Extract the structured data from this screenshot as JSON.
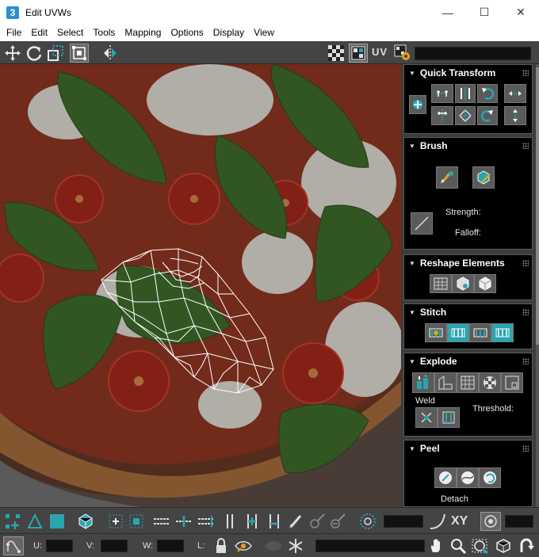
{
  "window": {
    "app_icon_text": "3",
    "title": "Edit UVWs",
    "minimize_glyph": "—",
    "maximize_glyph": "☐",
    "close_glyph": "✕"
  },
  "menu": [
    "File",
    "Edit",
    "Select",
    "Tools",
    "Mapping",
    "Options",
    "Display",
    "View"
  ],
  "toolbar": {
    "uv_label": "UV",
    "texture_dropdown_value": "",
    "icons": [
      "move-icon",
      "rotate-icon",
      "scale-icon",
      "freeform-icon",
      "mirror-icon",
      "checker-pattern-icon",
      "show-map-icon",
      "uv-label",
      "texture-settings-icon"
    ]
  },
  "panel": {
    "rollouts": [
      {
        "title": "Quick Transform"
      },
      {
        "title": "Brush"
      },
      {
        "title": "Reshape Elements"
      },
      {
        "title": "Stitch"
      },
      {
        "title": "Explode"
      },
      {
        "title": "Peel"
      }
    ],
    "brush_strength_label": "Strength:",
    "brush_falloff_label": "Falloff:",
    "explode_weld_label": "Weld",
    "explode_threshold_label": "Threshold:",
    "peel_detach_label": "Detach"
  },
  "bottom": {
    "xy_label": "XY",
    "u_label": "U:",
    "v_label": "V:",
    "w_label": "W:",
    "l_label": "L:",
    "u_value": "",
    "v_value": "",
    "w_value": "",
    "l_value": ""
  },
  "colors": {
    "panel_bg": "#3c3c3c",
    "rollout_bg": "#000000",
    "toolbar_bg": "#444444",
    "accent_teal": "#2aa5b0",
    "wireframe": "#ffffff"
  }
}
